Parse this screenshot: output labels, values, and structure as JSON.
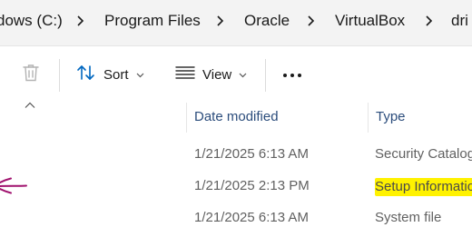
{
  "breadcrumb": {
    "items": [
      {
        "label": "dows (C:)"
      },
      {
        "label": "Program Files"
      },
      {
        "label": "Oracle"
      },
      {
        "label": "VirtualBox"
      },
      {
        "label": "dri"
      }
    ]
  },
  "toolbar": {
    "delete_icon": "trash-icon",
    "sort_label": "Sort",
    "view_label": "View",
    "more_label": "•••"
  },
  "columns": {
    "date_modified": "Date modified",
    "type": "Type"
  },
  "rows": [
    {
      "date": "1/21/2025 6:13 AM",
      "type": "Security Catalog",
      "highlighted": false
    },
    {
      "date": "1/21/2025 2:13 PM",
      "type": "Setup Information",
      "highlighted": true
    },
    {
      "date": "1/21/2025 6:13 AM",
      "type": "System file",
      "highlighted": false
    }
  ],
  "colors": {
    "header_text": "#2c4d7c",
    "highlight": "#fff200",
    "annotation": "#a0126e",
    "accent": "#0067c0"
  }
}
